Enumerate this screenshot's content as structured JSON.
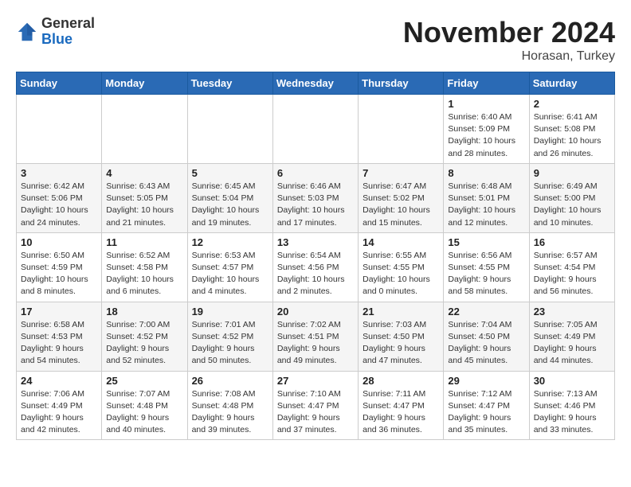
{
  "logo": {
    "general": "General",
    "blue": "Blue"
  },
  "header": {
    "month": "November 2024",
    "location": "Horasan, Turkey"
  },
  "days_of_week": [
    "Sunday",
    "Monday",
    "Tuesday",
    "Wednesday",
    "Thursday",
    "Friday",
    "Saturday"
  ],
  "weeks": [
    [
      {
        "day": "",
        "info": ""
      },
      {
        "day": "",
        "info": ""
      },
      {
        "day": "",
        "info": ""
      },
      {
        "day": "",
        "info": ""
      },
      {
        "day": "",
        "info": ""
      },
      {
        "day": "1",
        "info": "Sunrise: 6:40 AM\nSunset: 5:09 PM\nDaylight: 10 hours and 28 minutes."
      },
      {
        "day": "2",
        "info": "Sunrise: 6:41 AM\nSunset: 5:08 PM\nDaylight: 10 hours and 26 minutes."
      }
    ],
    [
      {
        "day": "3",
        "info": "Sunrise: 6:42 AM\nSunset: 5:06 PM\nDaylight: 10 hours and 24 minutes."
      },
      {
        "day": "4",
        "info": "Sunrise: 6:43 AM\nSunset: 5:05 PM\nDaylight: 10 hours and 21 minutes."
      },
      {
        "day": "5",
        "info": "Sunrise: 6:45 AM\nSunset: 5:04 PM\nDaylight: 10 hours and 19 minutes."
      },
      {
        "day": "6",
        "info": "Sunrise: 6:46 AM\nSunset: 5:03 PM\nDaylight: 10 hours and 17 minutes."
      },
      {
        "day": "7",
        "info": "Sunrise: 6:47 AM\nSunset: 5:02 PM\nDaylight: 10 hours and 15 minutes."
      },
      {
        "day": "8",
        "info": "Sunrise: 6:48 AM\nSunset: 5:01 PM\nDaylight: 10 hours and 12 minutes."
      },
      {
        "day": "9",
        "info": "Sunrise: 6:49 AM\nSunset: 5:00 PM\nDaylight: 10 hours and 10 minutes."
      }
    ],
    [
      {
        "day": "10",
        "info": "Sunrise: 6:50 AM\nSunset: 4:59 PM\nDaylight: 10 hours and 8 minutes."
      },
      {
        "day": "11",
        "info": "Sunrise: 6:52 AM\nSunset: 4:58 PM\nDaylight: 10 hours and 6 minutes."
      },
      {
        "day": "12",
        "info": "Sunrise: 6:53 AM\nSunset: 4:57 PM\nDaylight: 10 hours and 4 minutes."
      },
      {
        "day": "13",
        "info": "Sunrise: 6:54 AM\nSunset: 4:56 PM\nDaylight: 10 hours and 2 minutes."
      },
      {
        "day": "14",
        "info": "Sunrise: 6:55 AM\nSunset: 4:55 PM\nDaylight: 10 hours and 0 minutes."
      },
      {
        "day": "15",
        "info": "Sunrise: 6:56 AM\nSunset: 4:55 PM\nDaylight: 9 hours and 58 minutes."
      },
      {
        "day": "16",
        "info": "Sunrise: 6:57 AM\nSunset: 4:54 PM\nDaylight: 9 hours and 56 minutes."
      }
    ],
    [
      {
        "day": "17",
        "info": "Sunrise: 6:58 AM\nSunset: 4:53 PM\nDaylight: 9 hours and 54 minutes."
      },
      {
        "day": "18",
        "info": "Sunrise: 7:00 AM\nSunset: 4:52 PM\nDaylight: 9 hours and 52 minutes."
      },
      {
        "day": "19",
        "info": "Sunrise: 7:01 AM\nSunset: 4:52 PM\nDaylight: 9 hours and 50 minutes."
      },
      {
        "day": "20",
        "info": "Sunrise: 7:02 AM\nSunset: 4:51 PM\nDaylight: 9 hours and 49 minutes."
      },
      {
        "day": "21",
        "info": "Sunrise: 7:03 AM\nSunset: 4:50 PM\nDaylight: 9 hours and 47 minutes."
      },
      {
        "day": "22",
        "info": "Sunrise: 7:04 AM\nSunset: 4:50 PM\nDaylight: 9 hours and 45 minutes."
      },
      {
        "day": "23",
        "info": "Sunrise: 7:05 AM\nSunset: 4:49 PM\nDaylight: 9 hours and 44 minutes."
      }
    ],
    [
      {
        "day": "24",
        "info": "Sunrise: 7:06 AM\nSunset: 4:49 PM\nDaylight: 9 hours and 42 minutes."
      },
      {
        "day": "25",
        "info": "Sunrise: 7:07 AM\nSunset: 4:48 PM\nDaylight: 9 hours and 40 minutes."
      },
      {
        "day": "26",
        "info": "Sunrise: 7:08 AM\nSunset: 4:48 PM\nDaylight: 9 hours and 39 minutes."
      },
      {
        "day": "27",
        "info": "Sunrise: 7:10 AM\nSunset: 4:47 PM\nDaylight: 9 hours and 37 minutes."
      },
      {
        "day": "28",
        "info": "Sunrise: 7:11 AM\nSunset: 4:47 PM\nDaylight: 9 hours and 36 minutes."
      },
      {
        "day": "29",
        "info": "Sunrise: 7:12 AM\nSunset: 4:47 PM\nDaylight: 9 hours and 35 minutes."
      },
      {
        "day": "30",
        "info": "Sunrise: 7:13 AM\nSunset: 4:46 PM\nDaylight: 9 hours and 33 minutes."
      }
    ]
  ]
}
